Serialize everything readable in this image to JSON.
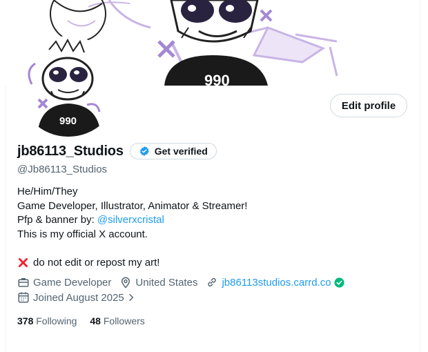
{
  "profile": {
    "display_name": "jb86113_Studios",
    "handle": "@Jb86113_Studios",
    "edit_label": "Edit profile",
    "get_verified_label": "Get verified"
  },
  "bio": {
    "line1": "He/Him/They",
    "line2": "Game Developer, Illustrator, Animator & Streamer!",
    "line3_prefix": "Pfp & banner by: ",
    "line3_mention": "@silverxcristal",
    "line4": "This is my official X account.",
    "line5": "do not edit or repost my art!"
  },
  "meta": {
    "profession": "Game Developer",
    "location": "United States",
    "website": "jb86113studios.carrd.co",
    "joined": "Joined August 2025"
  },
  "stats": {
    "following_count": "378",
    "following_label": "Following",
    "followers_count": "48",
    "followers_label": "Followers"
  },
  "colors": {
    "accent": "#1d9bf0",
    "muted_text": "#536471",
    "verified_green": "#00ba7c",
    "warning_red": "#f4212e",
    "art_purple": "#c8b4e6"
  },
  "icons": {
    "verified_badge": "verified-badge-icon",
    "briefcase": "briefcase-icon",
    "location": "location-pin-icon",
    "link": "link-icon",
    "calendar": "calendar-icon",
    "chevron": "chevron-right-icon",
    "cross_mark": "cross-mark-icon"
  }
}
